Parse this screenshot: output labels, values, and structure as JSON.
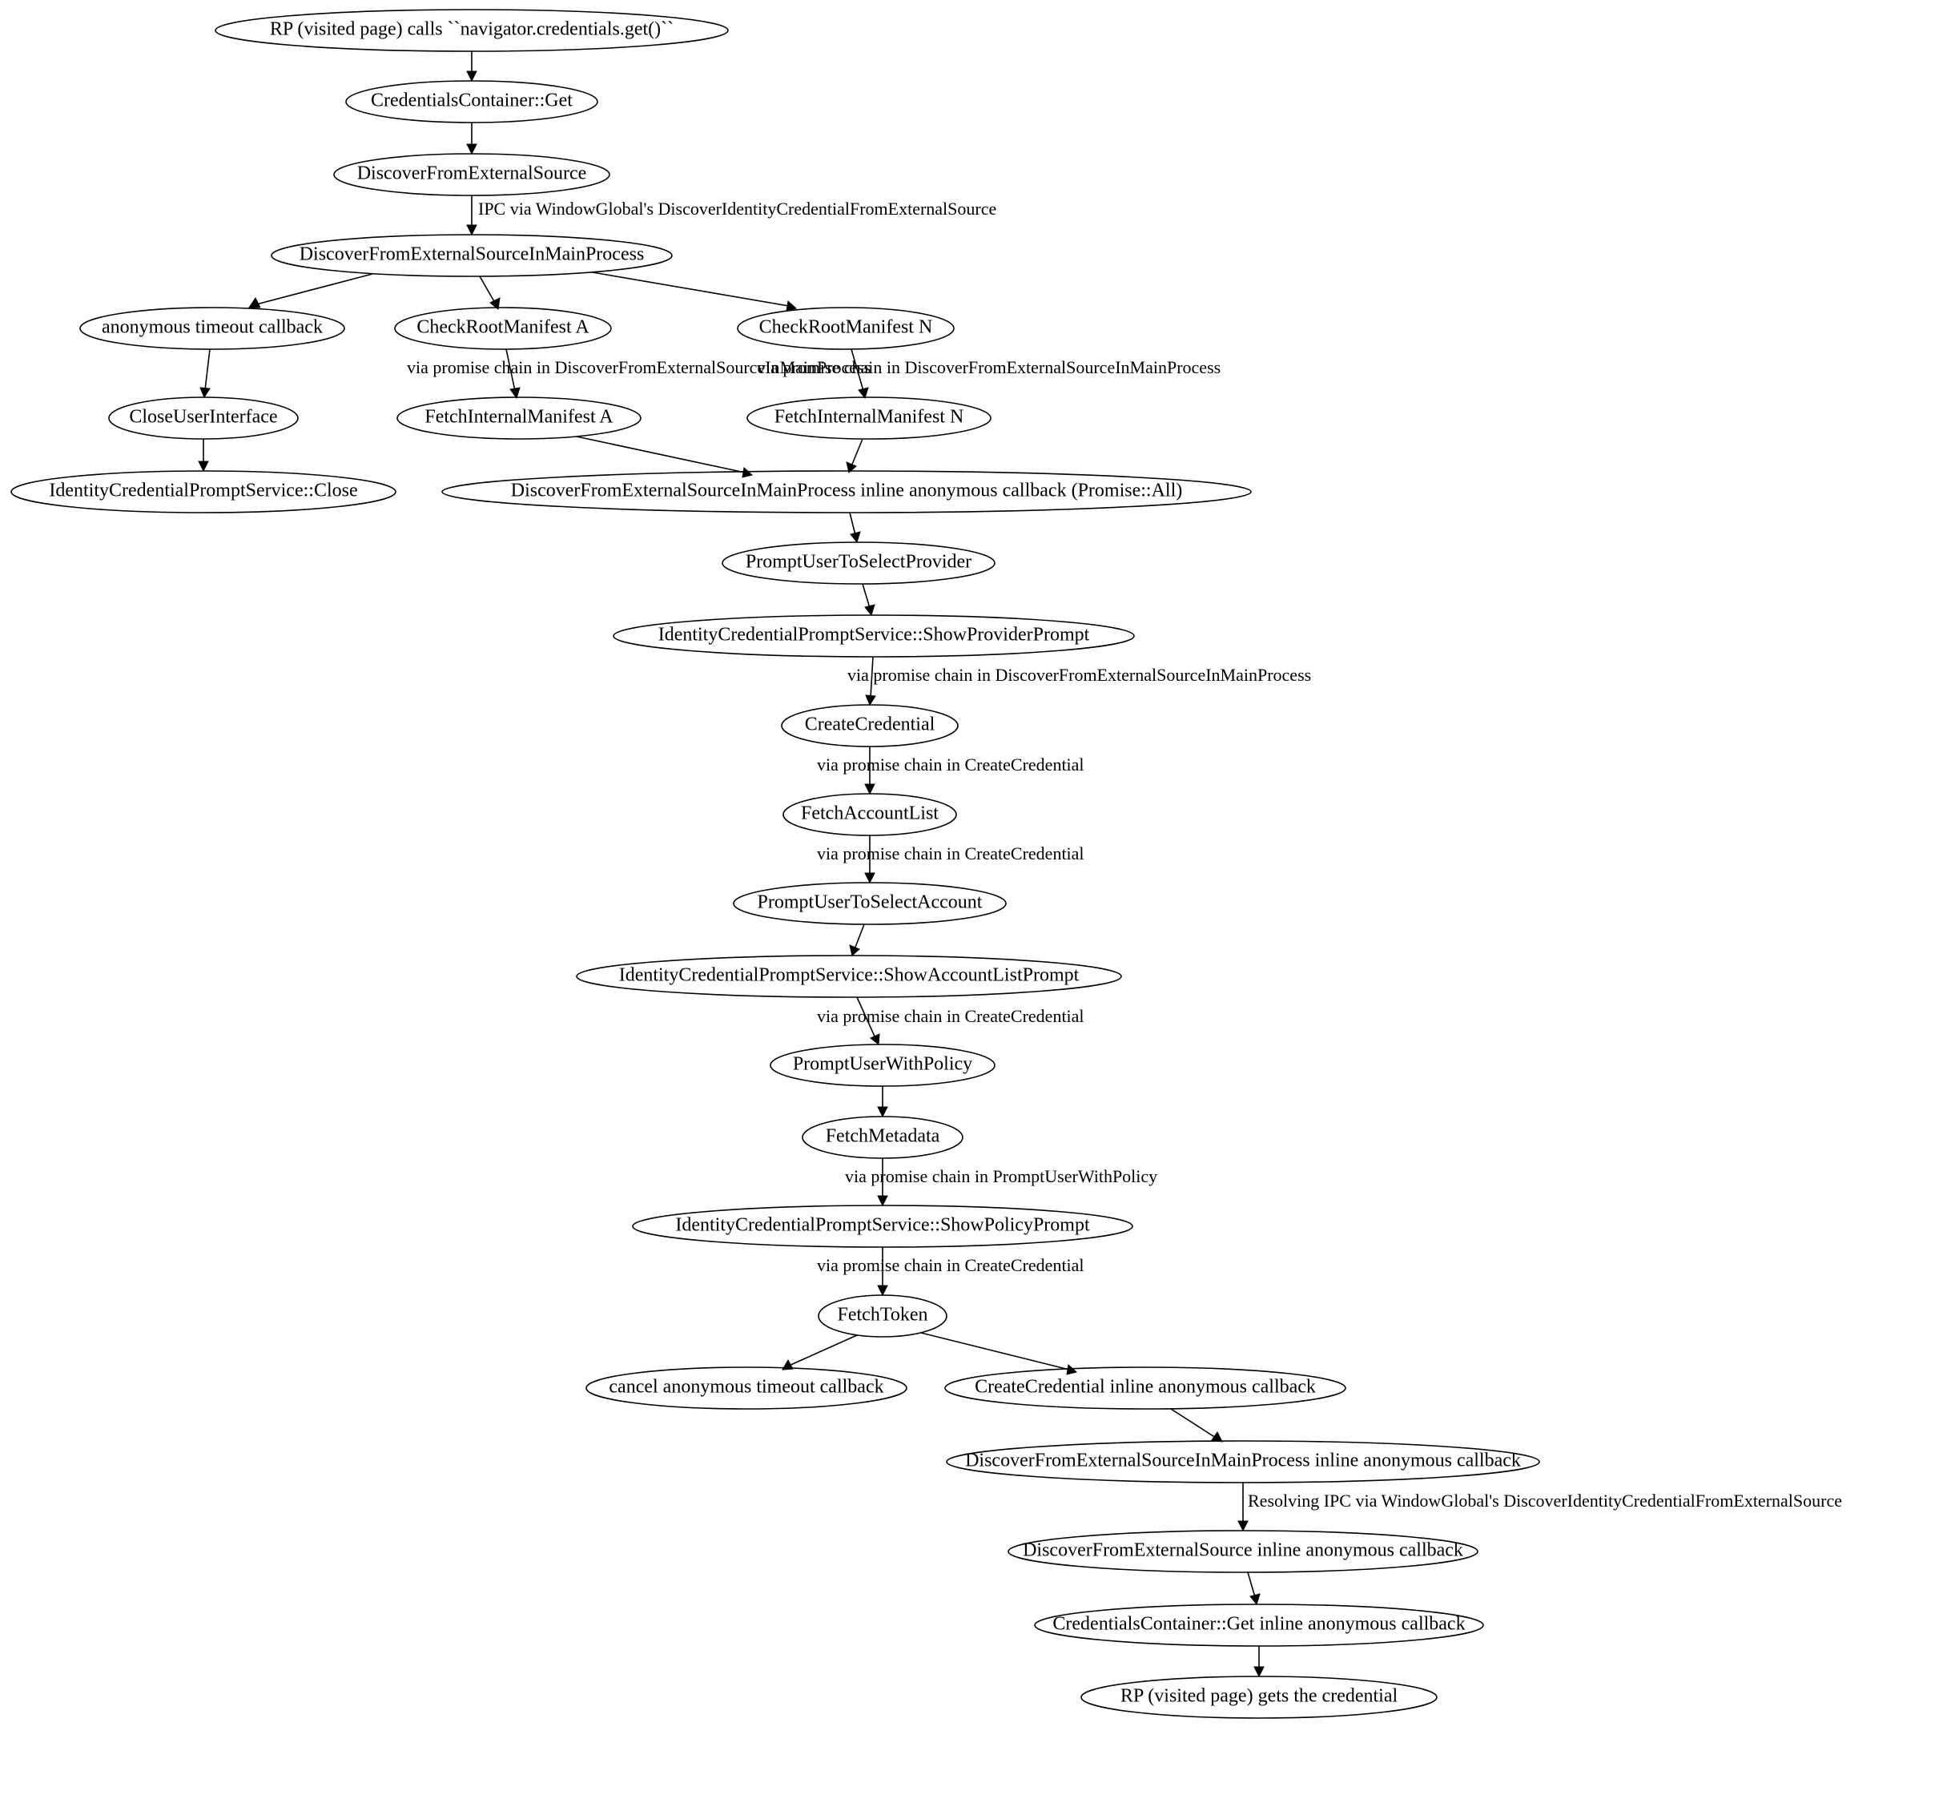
{
  "nodes": {
    "n0": "RP (visited page) calls ``navigator.credentials.get()``",
    "n1": "CredentialsContainer::Get",
    "n2": "DiscoverFromExternalSource",
    "n3": "DiscoverFromExternalSourceInMainProcess",
    "n4": "anonymous timeout callback",
    "n5": "CheckRootManifest A",
    "n6": "CheckRootManifest N",
    "n7": "CloseUserInterface",
    "n8": "FetchInternalManifest A",
    "n9": "FetchInternalManifest N",
    "n10": "IdentityCredentialPromptService::Close",
    "n11": "DiscoverFromExternalSourceInMainProcess inline anonymous callback (Promise::All)",
    "n12": "PromptUserToSelectProvider",
    "n13": "IdentityCredentialPromptService::ShowProviderPrompt",
    "n14": "CreateCredential",
    "n15": "FetchAccountList",
    "n16": "PromptUserToSelectAccount",
    "n17": "IdentityCredentialPromptService::ShowAccountListPrompt",
    "n18": "PromptUserWithPolicy",
    "n19": "FetchMetadata",
    "n20": "IdentityCredentialPromptService::ShowPolicyPrompt",
    "n21": "FetchToken",
    "n22": "cancel anonymous timeout callback",
    "n23": "CreateCredential inline anonymous callback",
    "n24": "DiscoverFromExternalSourceInMainProcess inline anonymous callback",
    "n25": "DiscoverFromExternalSource inline anonymous callback",
    "n26": "CredentialsContainer::Get inline anonymous callback",
    "n27": "RP (visited page) gets the credential"
  },
  "edges": {
    "e2_3": "IPC via WindowGlobal's DiscoverIdentityCredentialFromExternalSource",
    "e5_8": "via promise chain in DiscoverFromExternalSourceInMainProcess",
    "e6_9": "via promise chain in DiscoverFromExternalSourceInMainProcess",
    "e13_14": "via promise chain in DiscoverFromExternalSourceInMainProcess",
    "e14_15": "via promise chain in CreateCredential",
    "e15_16": "via promise chain in CreateCredential",
    "e17_18": "via promise chain in CreateCredential",
    "e19_20": "via promise chain in PromptUserWithPolicy",
    "e20_21": "via promise chain in CreateCredential",
    "e24_25": "Resolving IPC via WindowGlobal's DiscoverIdentityCredentialFromExternalSource"
  }
}
